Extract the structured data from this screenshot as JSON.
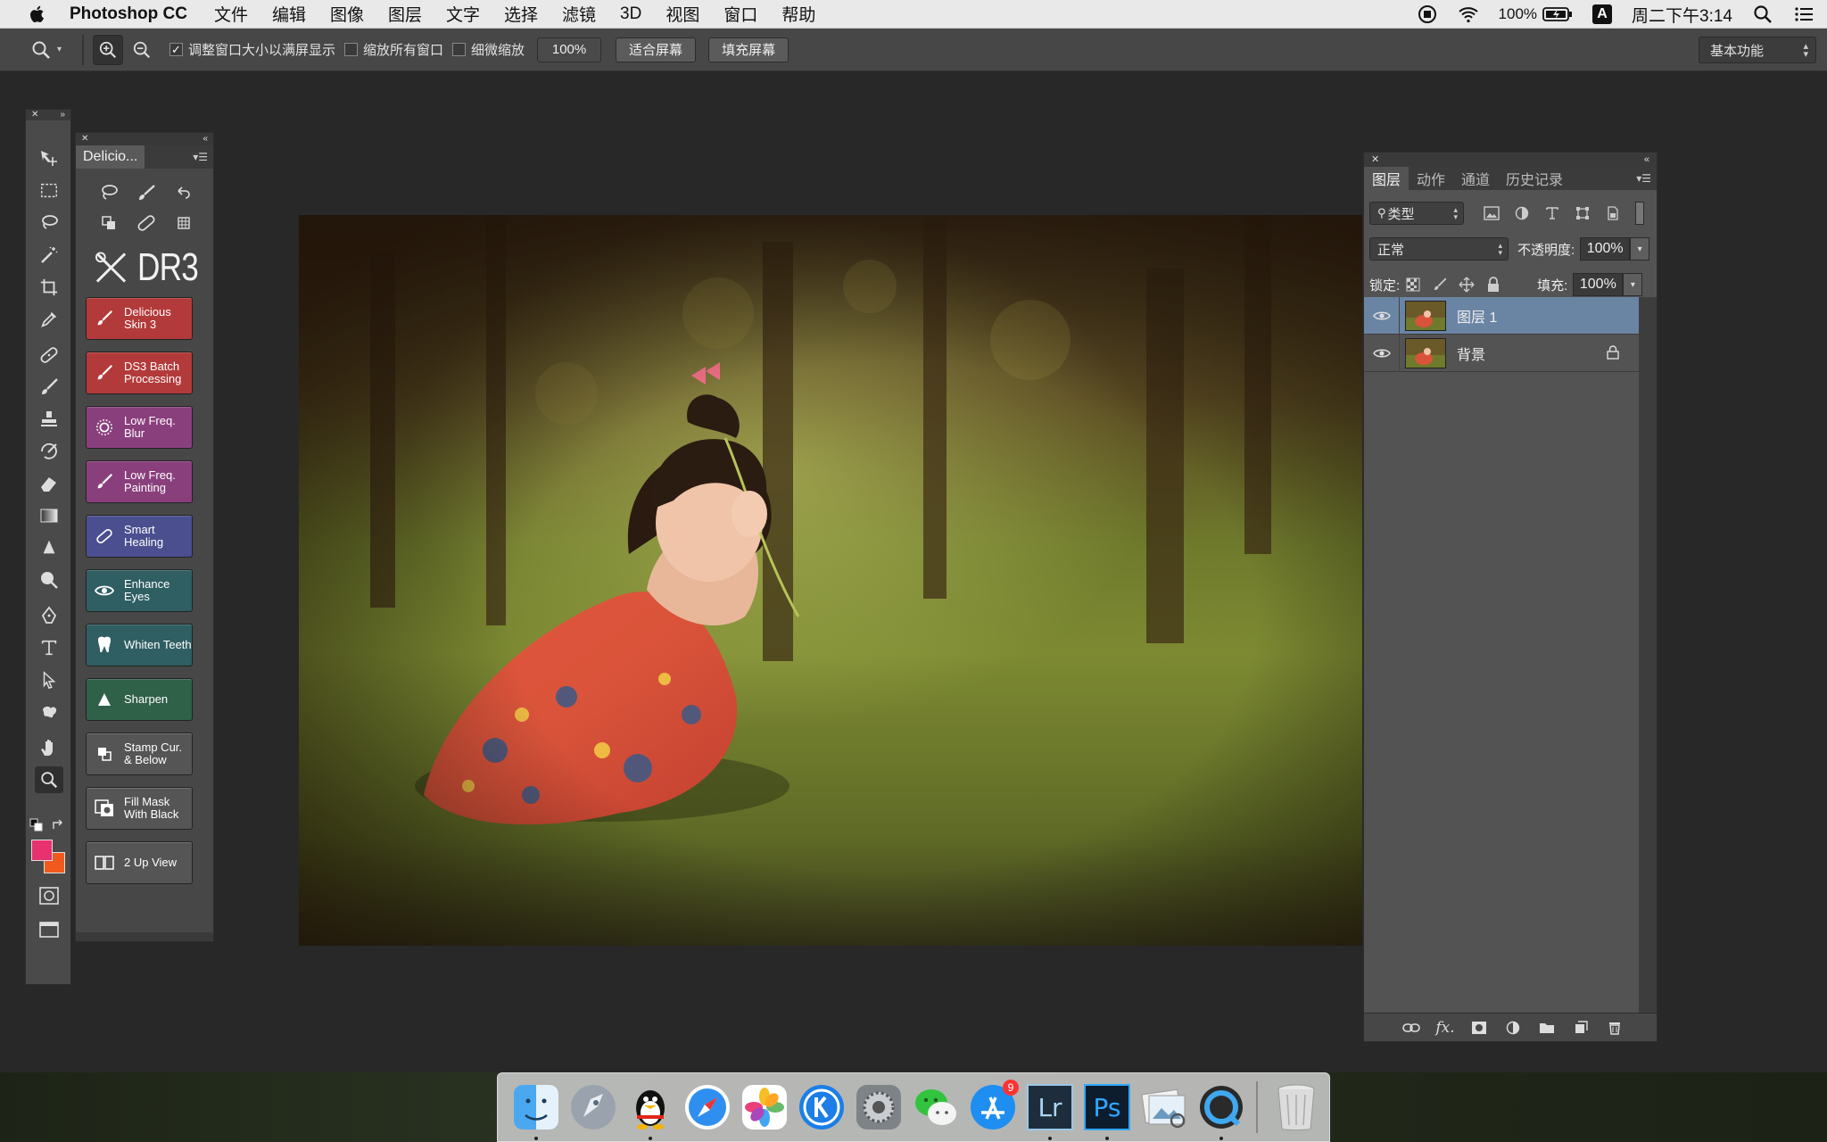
{
  "menubar": {
    "app_name": "Photoshop CC",
    "items": [
      "文件",
      "编辑",
      "图像",
      "图层",
      "文字",
      "选择",
      "滤镜",
      "3D",
      "视图",
      "窗口",
      "帮助"
    ],
    "battery": "100%",
    "input_method": "A",
    "clock": "周二下午3:14"
  },
  "options_bar": {
    "resize_windows_label": "调整窗口大小以满屏显示",
    "resize_windows_checked": true,
    "zoom_all_label": "缩放所有窗口",
    "scrubby_zoom_label": "细微缩放",
    "zoom_value": "100%",
    "fit_screen_label": "适合屏幕",
    "fill_screen_label": "填充屏幕",
    "workspace": "基本功能"
  },
  "colors": {
    "foreground": "#e8316f",
    "background": "#f05a1e",
    "layer_selected": "#6a84a3"
  },
  "plugin_panel": {
    "tab_title": "Delicio...",
    "logo": "DR3",
    "buttons": [
      {
        "label": "Delicious Skin 3",
        "color": "#b33a3a",
        "icon": "brush-icon"
      },
      {
        "label": "DS3 Batch Processing",
        "color": "#b33a3a",
        "icon": "brush-icon"
      },
      {
        "label": "Low Freq. Blur",
        "color": "#8a3f7d",
        "icon": "blur-icon"
      },
      {
        "label": "Low Freq. Painting",
        "color": "#8a3f7d",
        "icon": "brush-icon"
      },
      {
        "label": "Smart Healing",
        "color": "#4b4f8f",
        "icon": "bandage-icon"
      },
      {
        "label": "Enhance Eyes",
        "color": "#2f5e63",
        "icon": "eye-icon"
      },
      {
        "label": "Whiten Teeth",
        "color": "#2f5e63",
        "icon": "tooth-icon"
      },
      {
        "label": "Sharpen",
        "color": "#2f6048",
        "icon": "triangle-icon"
      },
      {
        "label": "Stamp Cur. & Below",
        "color": "#555555",
        "icon": "stamp-icon"
      },
      {
        "label": "Fill Mask With Black",
        "color": "#555555",
        "icon": "mask-icon"
      },
      {
        "label": "2 Up View",
        "color": "#555555",
        "icon": "split-view-icon"
      }
    ]
  },
  "layers_panel": {
    "tabs": [
      "图层",
      "动作",
      "通道",
      "历史记录"
    ],
    "active_tab": 0,
    "filter_kind": "类型",
    "blend_mode": "正常",
    "opacity_label": "不透明度:",
    "opacity": "100%",
    "lock_label": "锁定:",
    "fill_label": "填充:",
    "fill": "100%",
    "layers": [
      {
        "name": "图层 1",
        "selected": true,
        "locked": false
      },
      {
        "name": "背景",
        "selected": false,
        "locked": true
      }
    ]
  },
  "dock": {
    "apps": [
      {
        "name": "finder-icon",
        "running": true
      },
      {
        "name": "launchpad-icon",
        "running": false
      },
      {
        "name": "qq-icon",
        "running": true
      },
      {
        "name": "safari-icon",
        "running": false
      },
      {
        "name": "photos-icon",
        "running": false
      },
      {
        "name": "kugou-icon",
        "running": false
      },
      {
        "name": "system-preferences-icon",
        "running": false
      },
      {
        "name": "wechat-icon",
        "running": false
      },
      {
        "name": "app-store-icon",
        "running": false,
        "badge": "9"
      },
      {
        "name": "lightroom-icon",
        "running": true,
        "label": "Lr"
      },
      {
        "name": "photoshop-icon",
        "running": true,
        "label": "Ps"
      },
      {
        "name": "preview-icon",
        "running": false
      },
      {
        "name": "quicktime-icon",
        "running": true
      }
    ]
  }
}
